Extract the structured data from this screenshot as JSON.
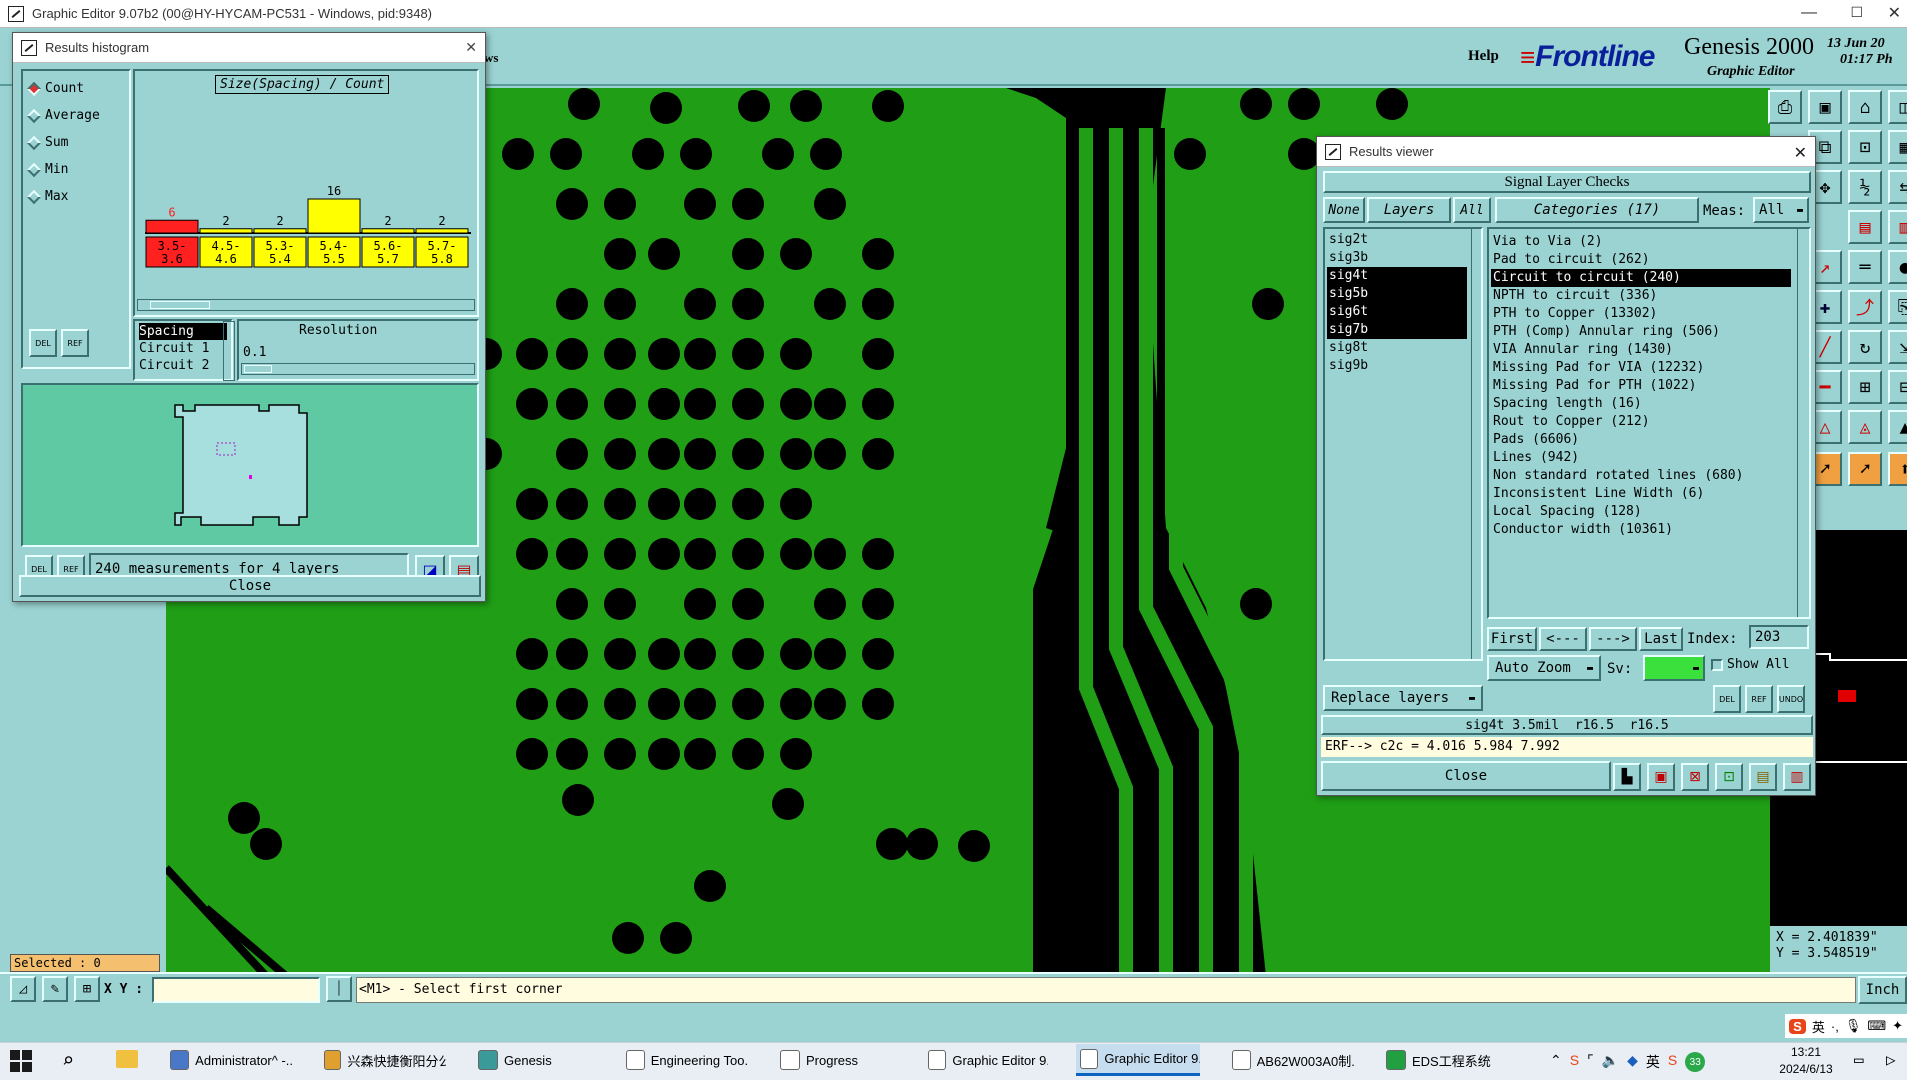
{
  "app": {
    "title": "Graphic Editor 9.07b2 (00@HY-HYCAM-PC531 - Windows, pid:9348)",
    "help": "Help",
    "brand": "Frontline",
    "product": "Genesis 2000",
    "product_sub": "Graphic Editor",
    "date": "13 Jun 20",
    "time": "01:17 Ph",
    "partial_menu": "ws"
  },
  "histogram": {
    "title": "Results histogram",
    "chart_title": "Size(Spacing) / Count",
    "stats": [
      {
        "label": "Count",
        "selected": true
      },
      {
        "label": "Average",
        "selected": false
      },
      {
        "label": "Sum",
        "selected": false
      },
      {
        "label": "Min",
        "selected": false
      },
      {
        "label": "Max",
        "selected": false
      }
    ],
    "del_label": "DEL",
    "ref_label": "REF",
    "list": [
      "Spacing",
      "Circuit 1",
      "Circuit 2"
    ],
    "resolution_label": "Resolution",
    "resolution_value": "0.1",
    "summary": "240 measurements for 4 layers",
    "close": "Close"
  },
  "chart_data": {
    "type": "bar",
    "title": "Size(Spacing) / Count",
    "categories": [
      "3.5-3.6",
      "4.5-4.6",
      "5.3-5.4",
      "5.4-5.5",
      "5.6-5.7",
      "5.7-5.8"
    ],
    "values": [
      6,
      2,
      2,
      16,
      2,
      2
    ],
    "colors": [
      "#ff2020",
      "#ffff00",
      "#ffff00",
      "#ffff00",
      "#ffff00",
      "#ffff00"
    ],
    "ylim": [
      0,
      16
    ]
  },
  "results_viewer": {
    "title": "Results viewer",
    "header": "Signal Layer Checks",
    "none": "None",
    "layers_label": "Layers",
    "all": "All",
    "categories_label": "Categories (17)",
    "meas_label": "Meas:",
    "meas_value": "All",
    "layers": [
      {
        "name": "sig2t",
        "selected": false
      },
      {
        "name": "sig3b",
        "selected": false
      },
      {
        "name": "sig4t",
        "selected": true
      },
      {
        "name": "sig5b",
        "selected": true
      },
      {
        "name": "sig6t",
        "selected": true
      },
      {
        "name": "sig7b",
        "selected": true
      },
      {
        "name": "sig8t",
        "selected": false
      },
      {
        "name": "sig9b",
        "selected": false
      }
    ],
    "categories": [
      {
        "label": "Via to Via (2)",
        "selected": false
      },
      {
        "label": "Pad to circuit (262)",
        "selected": false
      },
      {
        "label": "Circuit to circuit (240)",
        "selected": true
      },
      {
        "label": "NPTH to circuit (336)",
        "selected": false
      },
      {
        "label": "PTH to Copper (13302)",
        "selected": false
      },
      {
        "label": "PTH (Comp) Annular ring (506)",
        "selected": false
      },
      {
        "label": "VIA Annular ring (1430)",
        "selected": false
      },
      {
        "label": "Missing Pad for VIA (12232)",
        "selected": false
      },
      {
        "label": "Missing Pad for PTH (1022)",
        "selected": false
      },
      {
        "label": "Spacing length (16)",
        "selected": false
      },
      {
        "label": "Rout to Copper (212)",
        "selected": false
      },
      {
        "label": "Pads (6606)",
        "selected": false
      },
      {
        "label": "Lines (942)",
        "selected": false
      },
      {
        "label": "Non standard rotated lines (680)",
        "selected": false
      },
      {
        "label": "Inconsistent Line Width (6)",
        "selected": false
      },
      {
        "label": "Local Spacing (128)",
        "selected": false
      },
      {
        "label": "Conductor width (10361)",
        "selected": false
      }
    ],
    "nav": {
      "first": "First",
      "prev": "<---",
      "next": "--->",
      "last": "Last",
      "index_label": "Index:",
      "index_value": "203"
    },
    "auto_zoom": "Auto Zoom",
    "sv_label": "Sv:",
    "show_all": "Show All",
    "replace_layers": "Replace layers",
    "undo_label": "UNDO",
    "status_line": "sig4t 3.5mil  r16.5  r16.5",
    "erf_line": "ERF--> c2c = 4.016 5.984 7.992",
    "close": "Close"
  },
  "status": {
    "selected": "Selected : 0",
    "xy_label": "X Y :",
    "xy_value": "",
    "prompt": "<M1> - Select first corner",
    "unit": "Inch",
    "coord_x": "X = 2.401839\"",
    "coord_y": "Y = 3.548519\""
  },
  "taskbar": {
    "items": [
      {
        "label": "Administrator^ -...",
        "color": "#4a78c8",
        "active": false
      },
      {
        "label": "兴森快捷衡阳分公...",
        "color": "#e0a030",
        "active": false
      },
      {
        "label": "Genesis",
        "color": "#3a9a9a",
        "active": false
      },
      {
        "label": "Engineering Too...",
        "color": "#ffffff",
        "active": false
      },
      {
        "label": "Progress",
        "color": "#ffffff",
        "active": false
      },
      {
        "label": "Graphic Editor 9...",
        "color": "#ffffff",
        "active": false
      },
      {
        "label": "Graphic Editor 9...",
        "color": "#ffffff",
        "active": true
      },
      {
        "label": "AB62W003A0制...",
        "color": "#ffffff",
        "active": false
      },
      {
        "label": "EDS工程系统",
        "color": "#20a040",
        "active": false
      }
    ],
    "ime": "英",
    "time": "13:21",
    "date": "2024/6/13",
    "badge": "33"
  }
}
